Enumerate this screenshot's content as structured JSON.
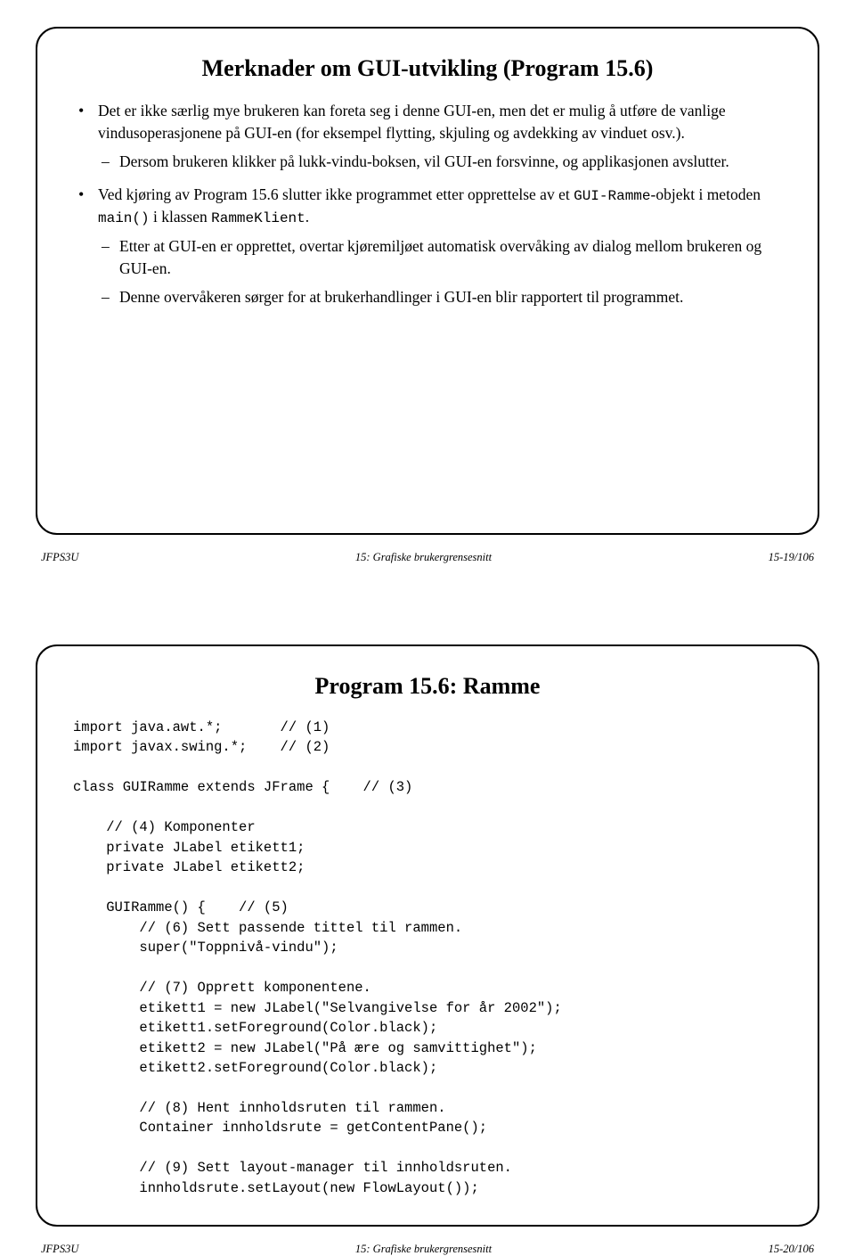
{
  "page1": {
    "title": "Merknader om GUI-utvikling (Program 15.6)",
    "bullet1": {
      "main": "Det er ikke særlig mye brukeren kan foreta seg i denne GUI-en, men det er mulig å utføre de vanlige vindusoperasjonene på GUI-en (for eksempel flytting, skjuling og avdekking av vinduet osv.).",
      "sub1": "Dersom brukeren klikker på lukk-vindu-boksen, vil GUI-en forsvinne, og applikasjonen avslutter."
    },
    "bullet2": {
      "main_a": "Ved kjøring av Program 15.6 slutter ikke programmet etter opprettelse av et ",
      "code1": "GUI-Ramme",
      "main_b": "-objekt i metoden ",
      "code2": "main()",
      "main_c": " i klassen ",
      "code3": "RammeKlient",
      "main_d": ".",
      "sub1": "Etter at GUI-en er opprettet, overtar kjøremiljøet automatisk overvåking av dialog mellom brukeren og GUI-en.",
      "sub2": "Denne overvåkeren sørger for at brukerhandlinger i GUI-en blir rapportert til programmet."
    },
    "footer": {
      "left": "JFPS3U",
      "center": "15: Grafiske brukergrensesnitt",
      "right": "15-19/106"
    }
  },
  "page2": {
    "title": "Program 15.6: Ramme",
    "code": "import java.awt.*;       // (1)\nimport javax.swing.*;    // (2)\n\nclass GUIRamme extends JFrame {    // (3)\n\n    // (4) Komponenter\n    private JLabel etikett1;\n    private JLabel etikett2;\n\n    GUIRamme() {    // (5)\n        // (6) Sett passende tittel til rammen.\n        super(\"Toppnivå-vindu\");\n\n        // (7) Opprett komponentene.\n        etikett1 = new JLabel(\"Selvangivelse for år 2002\");\n        etikett1.setForeground(Color.black);\n        etikett2 = new JLabel(\"På ære og samvittighet\");\n        etikett2.setForeground(Color.black);\n\n        // (8) Hent innholdsruten til rammen.\n        Container innholdsrute = getContentPane();\n\n        // (9) Sett layout-manager til innholdsruten.\n        innholdsrute.setLayout(new FlowLayout());",
    "footer": {
      "left": "JFPS3U",
      "center": "15: Grafiske brukergrensesnitt",
      "right": "15-20/106"
    }
  }
}
